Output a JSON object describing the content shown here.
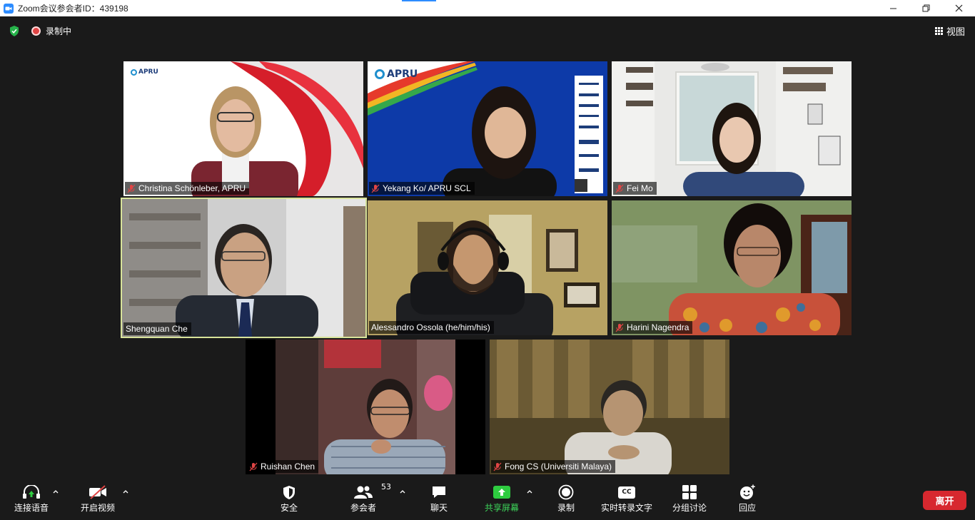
{
  "window": {
    "title": "Zoom会议参会者ID：439198",
    "app_icon": "zoom-camera-icon"
  },
  "topbar": {
    "recording_label": "录制中",
    "view_label": "视图",
    "colors": {
      "recording": "#e04545",
      "shield": "#26b34a"
    }
  },
  "participants": [
    {
      "name": "Christina Schönleber, APRU",
      "muted": true,
      "active": false,
      "logo_text": "APRU"
    },
    {
      "name": "Yekang Ko/ APRU SCL",
      "muted": true,
      "active": false,
      "logo_text": "APRU"
    },
    {
      "name": "Fei Mo",
      "muted": true,
      "active": false
    },
    {
      "name": "Shengquan Che",
      "muted": false,
      "active": true
    },
    {
      "name": "Alessandro Ossola (he/him/his)",
      "muted": false,
      "active": false
    },
    {
      "name": "Harini Nagendra",
      "muted": true,
      "active": false
    },
    {
      "name": "Ruishan Chen",
      "muted": true,
      "active": false
    },
    {
      "name": "Fong CS (Universiti Malaya)",
      "muted": true,
      "active": false
    }
  ],
  "toolbar": {
    "audio_label": "连接语音",
    "video_label": "开启视频",
    "security_label": "安全",
    "participants_label": "参会者",
    "participants_count": "53",
    "chat_label": "聊天",
    "share_label": "共享屏幕",
    "record_label": "录制",
    "captions_label": "实时转录文字",
    "captions_icon_text": "CC",
    "breakout_label": "分组讨论",
    "reactions_label": "回应",
    "leave_label": "离开",
    "colors": {
      "share": "#2ecc40",
      "leave": "#d7282f"
    }
  }
}
